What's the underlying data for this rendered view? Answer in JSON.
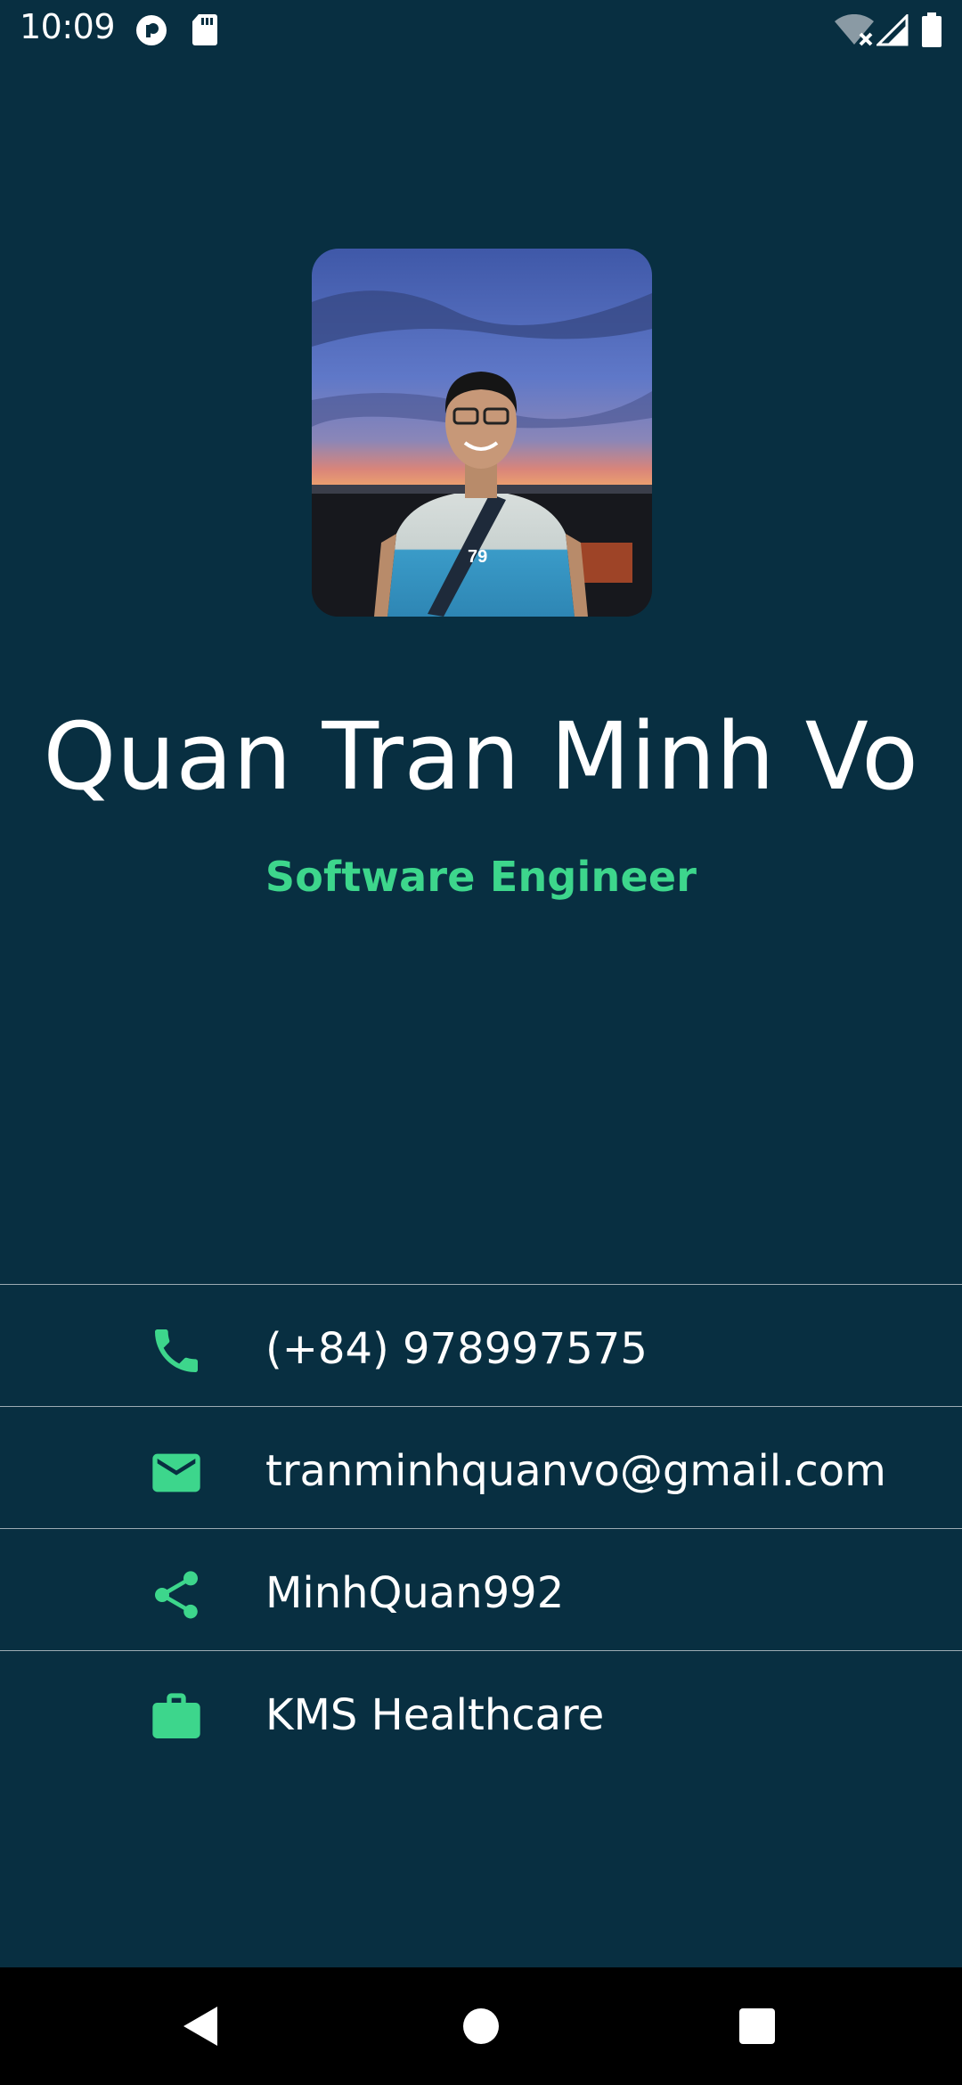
{
  "status_bar": {
    "time": "10:09",
    "icons": [
      "data-saver-icon",
      "sd-card-icon",
      "wifi-off-icon",
      "cell-signal-icon",
      "battery-icon"
    ]
  },
  "profile": {
    "name": "Quan Tran Minh Vo",
    "title": "Software Engineer"
  },
  "contacts": [
    {
      "icon": "phone-icon",
      "text": "(+84) 978997575"
    },
    {
      "icon": "email-icon",
      "text": "tranminhquanvo@gmail.com"
    },
    {
      "icon": "share-icon",
      "text": "MinhQuan992"
    },
    {
      "icon": "briefcase-icon",
      "text": "KMS Healthcare"
    }
  ],
  "nav_bar": {
    "buttons": [
      "back-button",
      "home-button",
      "recents-button"
    ]
  },
  "colors": {
    "background": "#082F41",
    "accent": "#3DD68C",
    "text": "#FFFFFF",
    "nav_background": "#000000"
  }
}
